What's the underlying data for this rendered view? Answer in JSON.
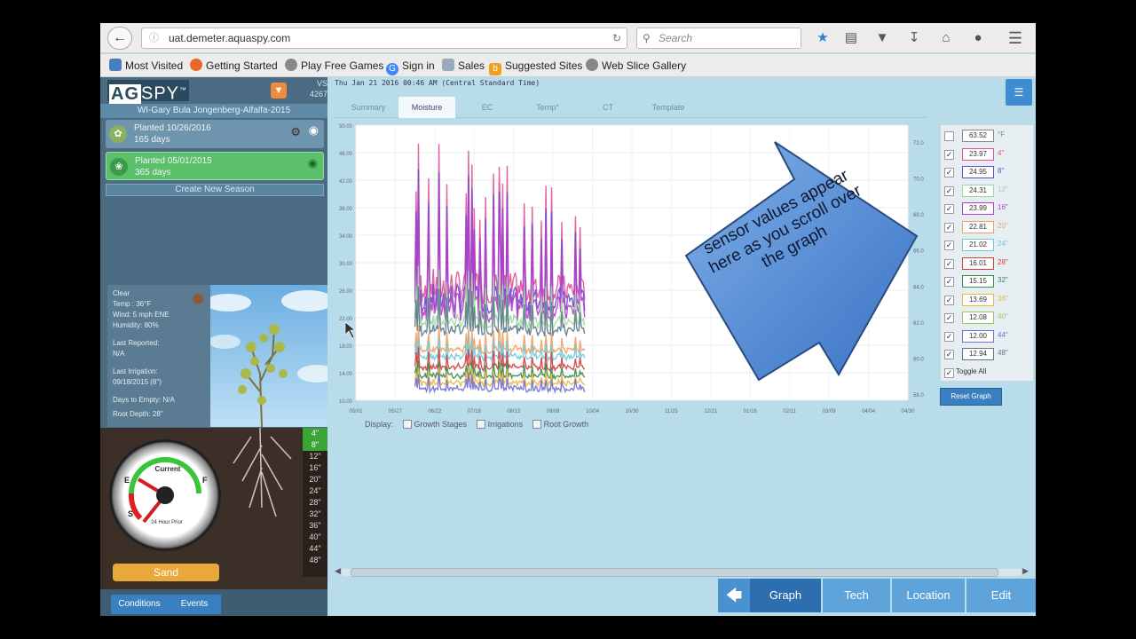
{
  "browser": {
    "url": "uat.demeter.aquaspy.com",
    "search_placeholder": "Search",
    "bookmarks": [
      "Most Visited",
      "Getting Started",
      "Play Free Games",
      "Sign in",
      "Sales",
      "Suggested Sites",
      "Web Slice Gallery"
    ]
  },
  "sidebar": {
    "logo_ag": "AG",
    "logo_spy": "SPY",
    "corner_top": "VS",
    "corner_id": "4267",
    "farm_name": "WI-Gary Bula Jongenberg-Alfalfa-2015",
    "seasons": [
      {
        "planted": "Planted 10/26/2016",
        "days": "165 days"
      },
      {
        "planted": "Planted 05/01/2015",
        "days": "365 days"
      }
    ],
    "create_season": "Create New Season",
    "weather": {
      "condition": "Clear",
      "temp": "Temp : 36°F",
      "wind": "Wind: 5 mph ENE",
      "humidity": "Humidity: 80%",
      "last_reported_label": "Last Reported:",
      "last_reported_value": "N/A",
      "last_irrigation_label": "Last Irrigation:",
      "last_irrigation_value": "09/18/2015 (8\")",
      "days_to_empty": "Days to Empty: N/A",
      "root_depth": "Root Depth: 28\""
    },
    "depths": [
      "4\"",
      "8\"",
      "12\"",
      "16\"",
      "20\"",
      "24\"",
      "28\"",
      "32\"",
      "36\"",
      "40\"",
      "44\"",
      "48\""
    ],
    "gauge_label": "Current",
    "gauge_sub": "24 Hour Prior",
    "gauge_letters": [
      "E",
      "F",
      "S"
    ],
    "soil_type": "Sand",
    "tabs": [
      "Conditions",
      "Events"
    ]
  },
  "main": {
    "timestamp": "Thu Jan 21 2016 00:46 AM (Central Standard Time)",
    "tabs": [
      "Summary",
      "Moisture",
      "EC",
      "Temp°",
      "CT",
      "Template"
    ],
    "active_tab": "Moisture",
    "display_label": "Display:",
    "display_options": [
      "Growth Stages",
      "Irrigations",
      "Root Growth"
    ],
    "reset_graph": "Reset Graph",
    "toggle_all": "Toggle All",
    "callout": "sensor values appear here as you scroll over the graph",
    "bottom_nav": [
      "Graph",
      "Tech",
      "Location",
      "Edit"
    ],
    "active_nav": "Graph"
  },
  "legend": [
    {
      "value": "63.52",
      "depth": "°F",
      "color": "#888888",
      "checked": false
    },
    {
      "value": "23.97",
      "depth": "4\"",
      "color": "#e0509a",
      "checked": true
    },
    {
      "value": "24.95",
      "depth": "8\"",
      "color": "#6a4ad0",
      "checked": true
    },
    {
      "value": "24.31",
      "depth": "12\"",
      "color": "#9fd8a0",
      "checked": true
    },
    {
      "value": "23.99",
      "depth": "16\"",
      "color": "#b040c8",
      "checked": true
    },
    {
      "value": "22.81",
      "depth": "20\"",
      "color": "#f0a060",
      "checked": true
    },
    {
      "value": "21.02",
      "depth": "24\"",
      "color": "#70c8d8",
      "checked": true
    },
    {
      "value": "16.01",
      "depth": "28\"",
      "color": "#d04040",
      "checked": true
    },
    {
      "value": "15.15",
      "depth": "32\"",
      "color": "#3a8a4a",
      "checked": true
    },
    {
      "value": "13.69",
      "depth": "36\"",
      "color": "#e8b840",
      "checked": true
    },
    {
      "value": "12.08",
      "depth": "40\"",
      "color": "#9ac860",
      "checked": true
    },
    {
      "value": "12.00",
      "depth": "44\"",
      "color": "#7070d0",
      "checked": true
    },
    {
      "value": "12.94",
      "depth": "48\"",
      "color": "#5a7a8a",
      "checked": true
    }
  ],
  "chart_data": {
    "type": "line",
    "ylim": [
      10,
      50
    ],
    "y_ticks": [
      "50.00",
      "46.00",
      "42.00",
      "38.00",
      "34.00",
      "30.00",
      "26.00",
      "22.00",
      "18.00",
      "14.00",
      "10.00"
    ],
    "y2_ticks": [
      "72.0",
      "70.0",
      "68.0",
      "66.0",
      "64.0",
      "62.0",
      "60.0",
      "58.0"
    ],
    "x_ticks": [
      "05/01",
      "05/27",
      "06/22",
      "07/18",
      "08/13",
      "09/08",
      "10/04",
      "10/30",
      "11/25",
      "12/21",
      "01/16",
      "02/11",
      "03/09",
      "04/04",
      "04/30"
    ],
    "data_span": [
      1.5,
      5.8
    ],
    "series": [
      {
        "color": "#e0509a",
        "base": 24,
        "peak": 49
      },
      {
        "color": "#6a4ad0",
        "base": 22.5,
        "peak": 45
      },
      {
        "color": "#b040c8",
        "base": 21.5,
        "peak": 43
      },
      {
        "color": "#9fd8a0",
        "base": 20.5,
        "peak": 30
      },
      {
        "color": "#5a7a8a",
        "base": 19.5,
        "peak": 27
      },
      {
        "color": "#f0a060",
        "base": 17,
        "peak": 21
      },
      {
        "color": "#70c8d8",
        "base": 16,
        "peak": 19.5
      },
      {
        "color": "#d04040",
        "base": 14.5,
        "peak": 18
      },
      {
        "color": "#3a8a4a",
        "base": 13.3,
        "peak": 16
      },
      {
        "color": "#e8b840",
        "base": 12.3,
        "peak": 15
      },
      {
        "color": "#7070d0",
        "base": 11.4,
        "peak": 14
      }
    ]
  }
}
